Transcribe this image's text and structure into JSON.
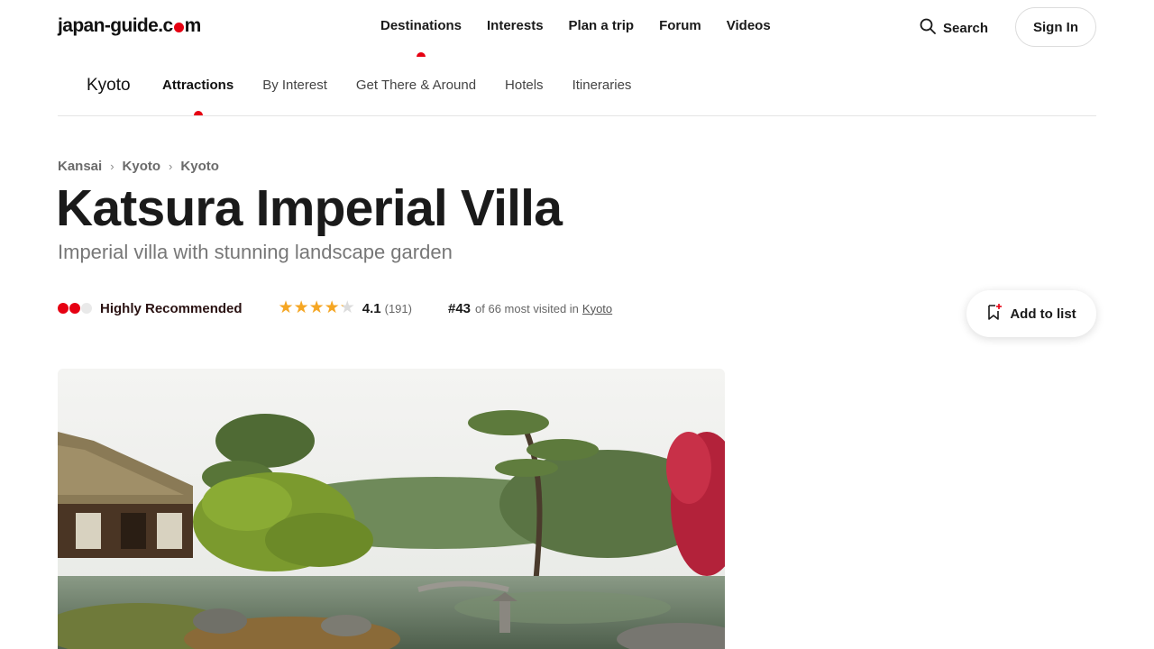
{
  "site": {
    "logo_part1": "japan-guide.c",
    "logo_part2": "m"
  },
  "main_nav": {
    "items": [
      {
        "label": "Destinations",
        "active": true
      },
      {
        "label": "Interests",
        "active": false
      },
      {
        "label": "Plan a trip",
        "active": false
      },
      {
        "label": "Forum",
        "active": false
      },
      {
        "label": "Videos",
        "active": false
      }
    ],
    "search_label": "Search",
    "signin_label": "Sign In"
  },
  "sub_nav": {
    "city": "Kyoto",
    "tabs": [
      {
        "label": "Attractions",
        "active": true
      },
      {
        "label": "By Interest",
        "active": false
      },
      {
        "label": "Get There & Around",
        "active": false
      },
      {
        "label": "Hotels",
        "active": false
      },
      {
        "label": "Itineraries",
        "active": false
      }
    ]
  },
  "breadcrumb": [
    "Kansai",
    "Kyoto",
    "Kyoto"
  ],
  "page": {
    "title": "Katsura Imperial Villa",
    "subtitle": "Imperial villa with stunning landscape garden"
  },
  "meta": {
    "recommendation": "Highly Recommended",
    "recommendation_level": 2,
    "recommendation_max": 3,
    "rating": "4.1",
    "rating_value": 4.1,
    "rating_count": "(191)",
    "rank": "#43",
    "rank_text": "of 66 most visited in",
    "rank_link": "Kyoto"
  },
  "actions": {
    "add_to_list": "Add to list"
  },
  "colors": {
    "brand_red": "#e60012",
    "star": "#f5a623"
  },
  "icons": {
    "search": "search-icon",
    "bookmark": "bookmark-plus-icon"
  }
}
